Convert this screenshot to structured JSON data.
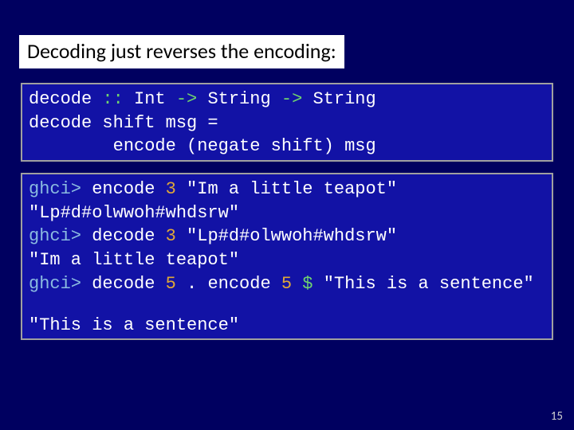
{
  "heading": "Decoding just reverses the encoding:",
  "code1": {
    "l1a": "decode ",
    "l1b": ":: ",
    "l1c": "Int ",
    "l1d": "-> ",
    "l1e": "String ",
    "l1f": "-> ",
    "l1g": "String",
    "l2": "decode shift msg =",
    "l3": "        encode (negate shift) msg"
  },
  "code2": {
    "l1a": "ghci> ",
    "l1b": "encode ",
    "l1c": "3 ",
    "l1d": "\"Im a little teapot\"",
    "l2": "\"Lp#d#olwwoh#whdsrw\"",
    "l3a": "ghci> ",
    "l3b": "decode ",
    "l3c": "3 ",
    "l3d": "\"Lp#d#olwwoh#whdsrw\"",
    "l4": "\"Im a little teapot\"",
    "l5a": "ghci> ",
    "l5b": "decode ",
    "l5c": "5 ",
    "l5d": ". encode ",
    "l5e": "5 ",
    "l5f": "$ ",
    "l5g": "\"This is a sentence\"",
    "l7": "\"This is a sentence\""
  },
  "page": "15"
}
